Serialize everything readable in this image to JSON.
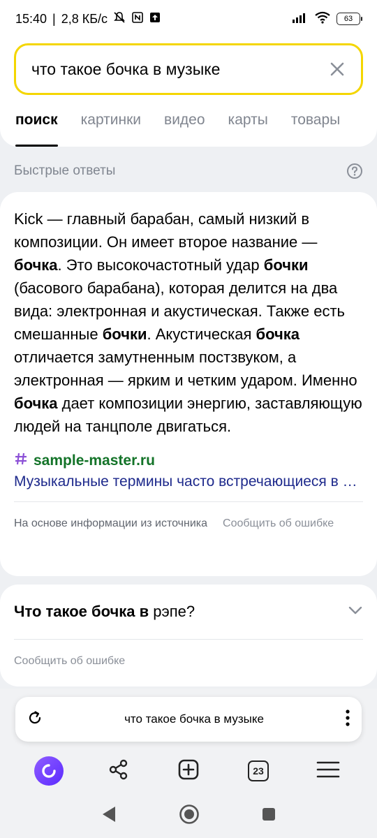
{
  "status_bar": {
    "time": "15:40",
    "speed": "2,8 КБ/с",
    "battery": "63"
  },
  "search": {
    "query": "что такое бочка в музыке"
  },
  "tabs": [
    {
      "label": "поиск",
      "active": true
    },
    {
      "label": "картинки",
      "active": false
    },
    {
      "label": "видео",
      "active": false
    },
    {
      "label": "карты",
      "active": false
    },
    {
      "label": "товары",
      "active": false
    }
  ],
  "quick_answers": {
    "title": "Быстрые ответы",
    "answer_html": "Kick — главный барабан, самый низкий в композиции. Он имеет второе название — <b>бочка</b>. Это высокочастотный удар <b>бочки</b> (басового барабана), которая делится на два вида: электронная и акустическая. Также есть смешанные <b>бочки</b>. Акустическая <b>бочка</b> отличается замутненным постзвуком, а электронная — ярким и четким ударом. Именно <b>бочка</b> дает композиции энергию, заставляющую людей на танцполе двигаться.",
    "source_domain": "sample-master.ru",
    "source_title": "Музыкальные термины часто встречающиеся в среде звукорежиссеров",
    "based_on": "На основе информации из источника",
    "report": "Сообщить об ошибке"
  },
  "question": {
    "bold_part": "Что такое бочка в",
    "rest": " рэпе?",
    "report": "Сообщить об ошибке"
  },
  "omnibox": {
    "text": "что такое бочка в музыке"
  },
  "toolbar": {
    "tabs_count": "23"
  },
  "colors": {
    "search_border": "#f4d600",
    "source_domain": "#137328",
    "source_link": "#1e2a8c",
    "alice": "#6b3cff"
  }
}
